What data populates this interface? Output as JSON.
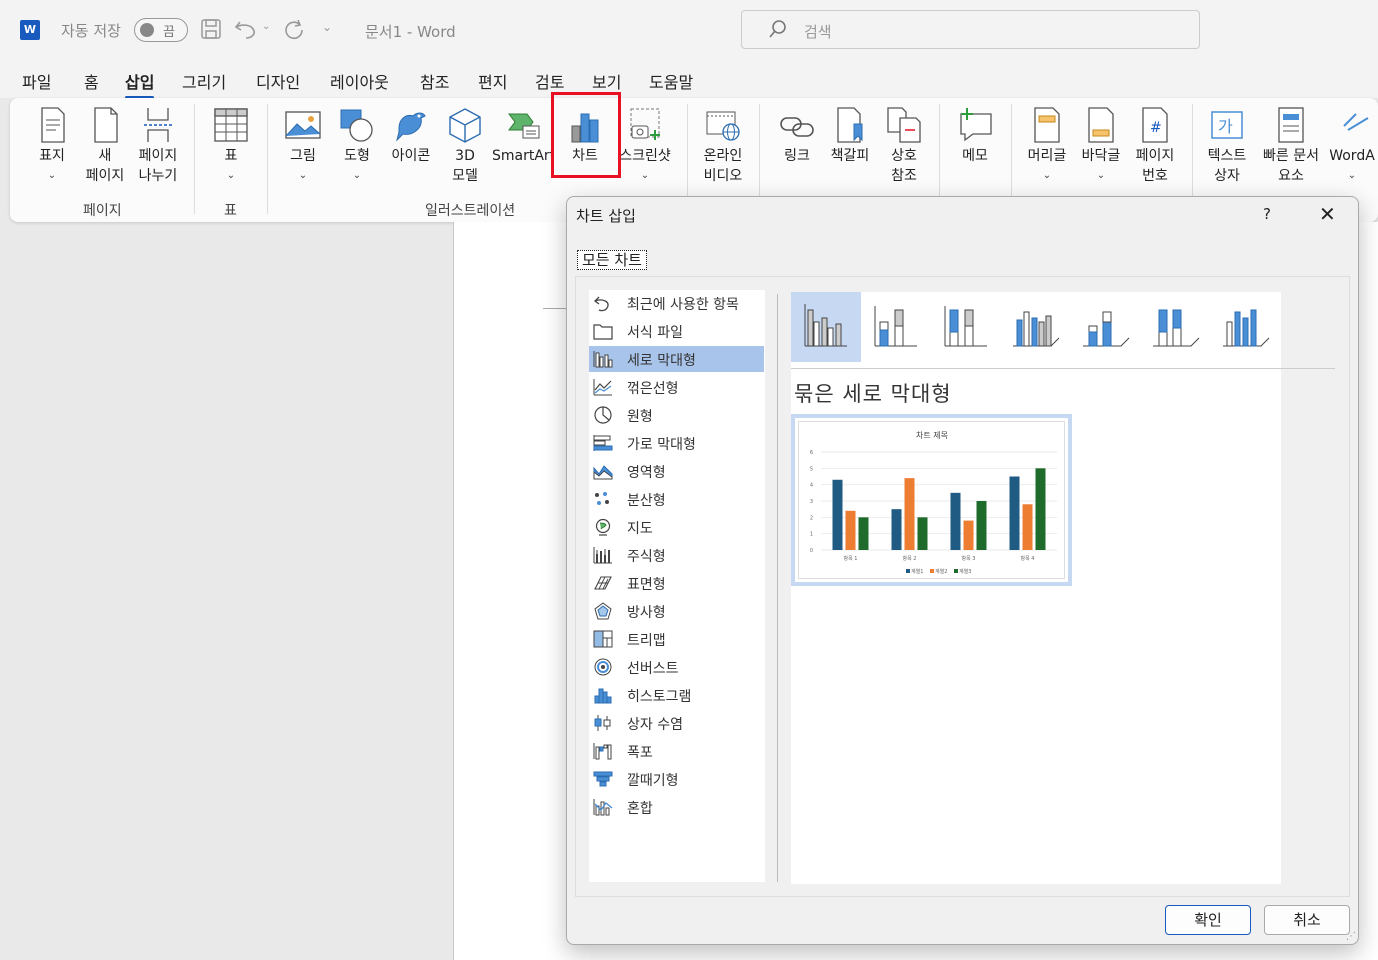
{
  "titlebar": {
    "app_logo": "W",
    "autosave_label": "자동 저장",
    "autosave_state": "끔",
    "doc_title": "문서1  -  Word",
    "search_placeholder": "검색"
  },
  "tabs": [
    "파일",
    "홈",
    "삽입",
    "그리기",
    "디자인",
    "레이아웃",
    "참조",
    "편지",
    "검토",
    "보기",
    "도움말"
  ],
  "active_tab": "삽입",
  "ribbon": {
    "groups": {
      "pages": "페이지",
      "table": "표",
      "illustrations": "일러스트레이션"
    },
    "buttons": {
      "cover": {
        "l1": "표지",
        "l2": ""
      },
      "new_page": {
        "l1": "새",
        "l2": "페이지"
      },
      "page_break": {
        "l1": "페이지",
        "l2": "나누기"
      },
      "table": {
        "l1": "표",
        "l2": ""
      },
      "pictures": {
        "l1": "그림",
        "l2": ""
      },
      "shapes": {
        "l1": "도형",
        "l2": ""
      },
      "icons": {
        "l1": "아이콘",
        "l2": ""
      },
      "models3d": {
        "l1": "3D",
        "l2": "모델"
      },
      "smartart": {
        "l1": "SmartArt",
        "l2": ""
      },
      "chart": {
        "l1": "차트",
        "l2": ""
      },
      "screenshot": {
        "l1": "스크린샷",
        "l2": ""
      },
      "online_video": {
        "l1": "온라인",
        "l2": "비디오"
      },
      "link": {
        "l1": "링크",
        "l2": ""
      },
      "bookmark": {
        "l1": "책갈피",
        "l2": ""
      },
      "cross_ref": {
        "l1": "상호",
        "l2": "참조"
      },
      "comment": {
        "l1": "메모",
        "l2": ""
      },
      "header": {
        "l1": "머리글",
        "l2": ""
      },
      "footer": {
        "l1": "바닥글",
        "l2": ""
      },
      "page_number": {
        "l1": "페이지",
        "l2": "번호"
      },
      "textbox": {
        "l1": "텍스트",
        "l2": "상자"
      },
      "quick_parts": {
        "l1": "빠른 문서",
        "l2": "요소"
      },
      "wordart": {
        "l1": "WordA",
        "l2": ""
      }
    }
  },
  "dialog": {
    "title": "차트 삽입",
    "help": "?",
    "close": "✕",
    "tab_all": "모든 차트",
    "chart_types": [
      "최근에 사용한 항목",
      "서식 파일",
      "세로 막대형",
      "꺾은선형",
      "원형",
      "가로 막대형",
      "영역형",
      "분산형",
      "지도",
      "주식형",
      "표면형",
      "방사형",
      "트리맵",
      "선버스트",
      "히스토그램",
      "상자 수염",
      "폭포",
      "깔때기형",
      "혼합"
    ],
    "selected_type": "세로 막대형",
    "subtype_name": "묶은 세로 막대형",
    "ok": "확인",
    "cancel": "취소"
  },
  "chart_data": {
    "type": "bar",
    "title": "차트 제목",
    "categories": [
      "항목 1",
      "항목 2",
      "항목 3",
      "항목 4"
    ],
    "series": [
      {
        "name": "계열1",
        "values": [
          4.3,
          2.5,
          3.5,
          4.5
        ],
        "color": "#1f5b82"
      },
      {
        "name": "계열2",
        "values": [
          2.4,
          4.4,
          1.8,
          2.8
        ],
        "color": "#ed7d31"
      },
      {
        "name": "계열3",
        "values": [
          2,
          2,
          3,
          5
        ],
        "color": "#1e6b2c"
      }
    ],
    "ylim": [
      0,
      6
    ],
    "yticks": [
      0,
      1,
      2,
      3,
      4,
      5,
      6
    ],
    "grid": true,
    "legend": "bottom"
  },
  "colors": {
    "accent": "#185abd",
    "highlight": "#e81123",
    "selection": "#a9c4ea"
  }
}
